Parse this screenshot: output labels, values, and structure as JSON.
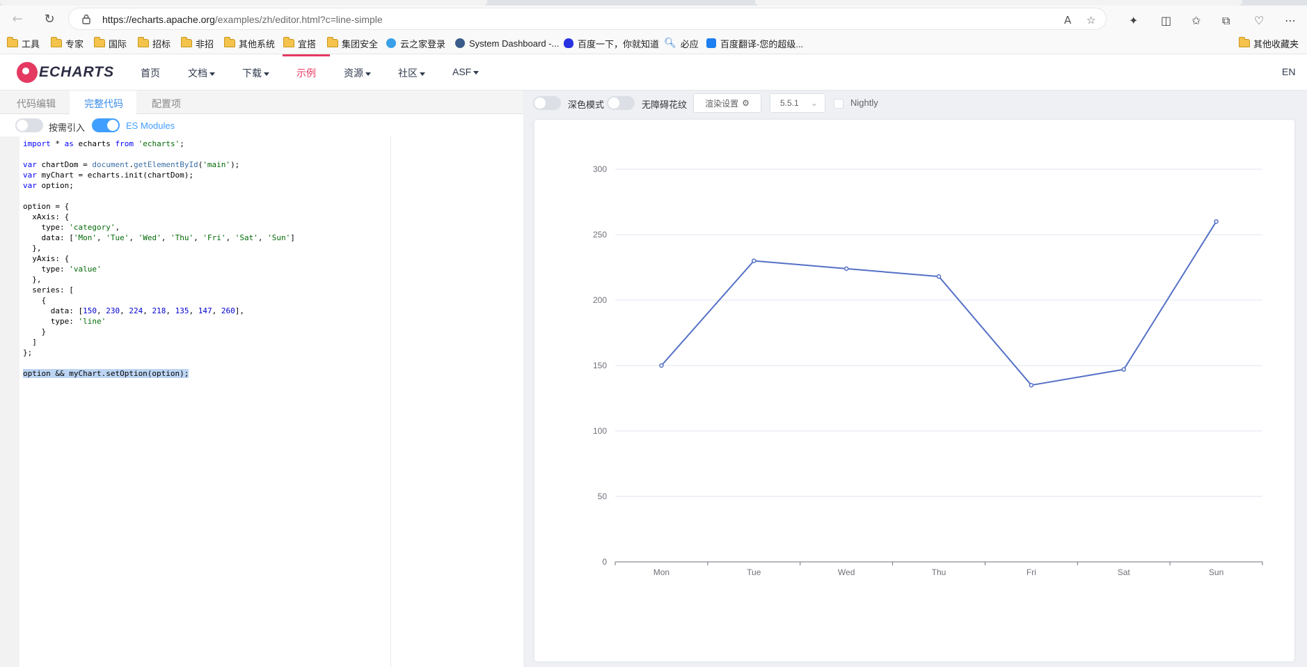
{
  "browser": {
    "url_host": "https://echarts.apache.org",
    "url_path": "/examples/zh/editor.html?c=line-simple"
  },
  "bookmarks": [
    {
      "label": "工具",
      "type": "folder"
    },
    {
      "label": "专家",
      "type": "folder"
    },
    {
      "label": "国际",
      "type": "folder"
    },
    {
      "label": "招标",
      "type": "folder"
    },
    {
      "label": "非招",
      "type": "folder"
    },
    {
      "label": "其他系统",
      "type": "folder"
    },
    {
      "label": "宜搭",
      "type": "folder"
    },
    {
      "label": "集团安全",
      "type": "folder"
    },
    {
      "label": "云之家登录",
      "type": "site"
    },
    {
      "label": "System Dashboard -...",
      "type": "site"
    },
    {
      "label": "百度一下，你就知道",
      "type": "site"
    },
    {
      "label": "必应",
      "type": "site"
    },
    {
      "label": "百度翻译-您的超级...",
      "type": "site"
    }
  ],
  "bookmarks_other": "其他收藏夹",
  "site": {
    "logo": "ECHARTS",
    "nav": {
      "home": "首页",
      "docs": "文档",
      "download": "下载",
      "examples": "示例",
      "resources": "资源",
      "community": "社区",
      "asf": "ASF"
    },
    "lang": "EN"
  },
  "editor": {
    "tabs": {
      "code_edit": "代码编辑",
      "full_code": "完整代码",
      "options": "配置项"
    },
    "options": {
      "on_demand": "按需引入",
      "es_modules": "ES Modules"
    }
  },
  "preview": {
    "dark_mode": "深色模式",
    "accessible_pattern": "无障碍花纹",
    "render_settings": "渲染设置",
    "version": "5.5.1",
    "nightly": "Nightly"
  },
  "chart_data": {
    "type": "line",
    "categories": [
      "Mon",
      "Tue",
      "Wed",
      "Thu",
      "Fri",
      "Sat",
      "Sun"
    ],
    "values": [
      150,
      230,
      224,
      218,
      135,
      147,
      260
    ],
    "ylim": [
      0,
      300
    ],
    "yticks": [
      0,
      50,
      100,
      150,
      200,
      250,
      300
    ],
    "grid": true,
    "color": "#5470c6"
  }
}
